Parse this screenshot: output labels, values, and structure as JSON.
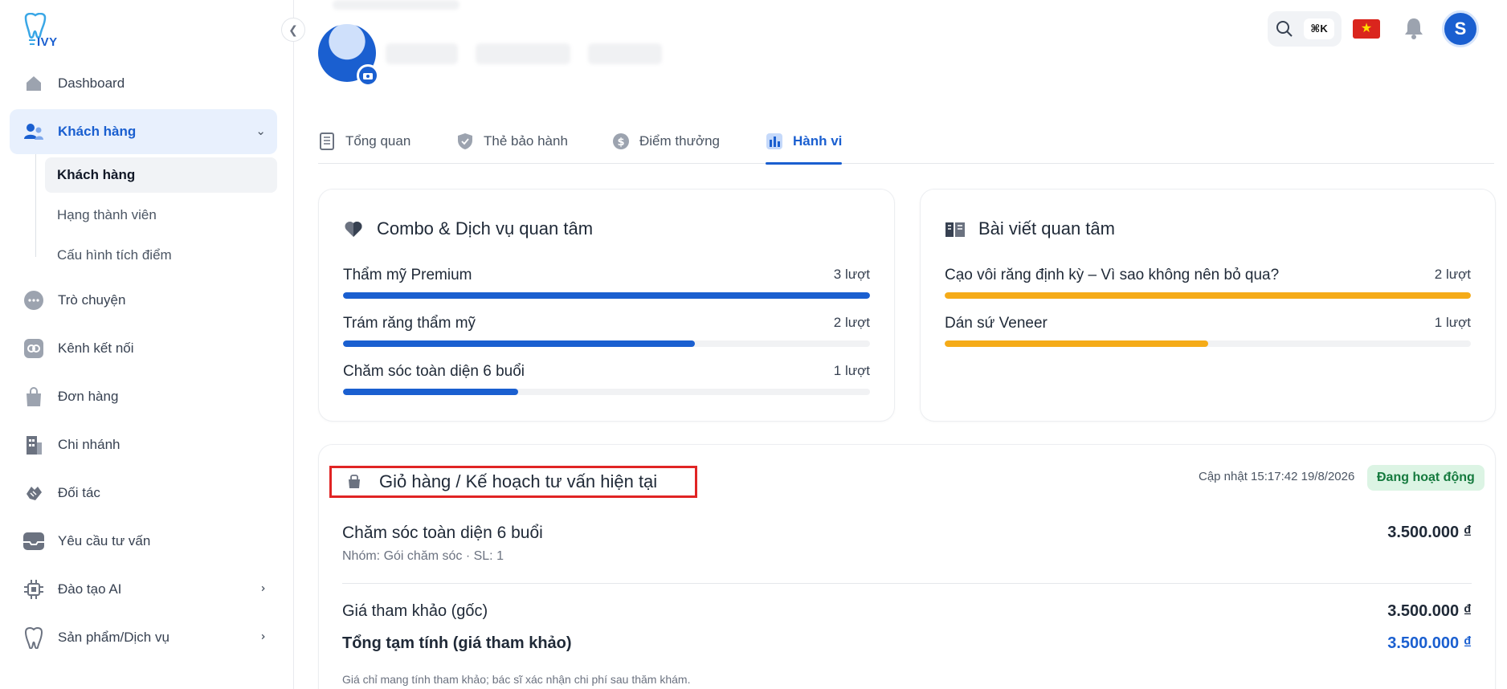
{
  "brand": {
    "logo_text": "IVY",
    "primary": "#1a5fd0"
  },
  "sidebar": {
    "items": [
      {
        "label": "Dashboard",
        "icon": "home-icon"
      },
      {
        "label": "Khách hàng",
        "icon": "users-icon",
        "active": true
      },
      {
        "label": "Trò chuyện",
        "icon": "chat-icon"
      },
      {
        "label": "Kênh kết nối",
        "icon": "link-icon"
      },
      {
        "label": "Đơn hàng",
        "icon": "bag-icon"
      },
      {
        "label": "Chi nhánh",
        "icon": "building-icon"
      },
      {
        "label": "Đối tác",
        "icon": "handshake-icon"
      },
      {
        "label": "Yêu cầu tư vấn",
        "icon": "inbox-icon"
      },
      {
        "label": "Đào tạo AI",
        "icon": "chip-icon"
      },
      {
        "label": "Sản phẩm/Dịch vụ",
        "icon": "tooth-icon"
      }
    ],
    "sub_items": [
      {
        "label": "Khách hàng",
        "active": true
      },
      {
        "label": "Hạng thành viên"
      },
      {
        "label": "Cấu hình tích điểm"
      }
    ]
  },
  "header": {
    "search_shortcut": "⌘K",
    "flag": "vn-flag-icon",
    "avatar_letter": "S"
  },
  "tabs": [
    {
      "label": "Tổng quan",
      "icon": "notebook-icon"
    },
    {
      "label": "Thẻ bảo hành",
      "icon": "shield-icon"
    },
    {
      "label": "Điểm thưởng",
      "icon": "dollar-icon"
    },
    {
      "label": "Hành vi",
      "icon": "chart-icon",
      "active": true
    }
  ],
  "combo_card": {
    "title": "Combo & Dịch vụ quan tâm",
    "rows": [
      {
        "name": "Thẩm mỹ Premium",
        "count": "3 lượt",
        "ratio": 1.0
      },
      {
        "name": "Trám răng thẩm mỹ",
        "count": "2 lượt",
        "ratio": 0.667
      },
      {
        "name": "Chăm sóc toàn diện 6 buổi",
        "count": "1 lượt",
        "ratio": 0.333
      }
    ],
    "bar_color": "#1a5fd0"
  },
  "articles_card": {
    "title": "Bài viết quan tâm",
    "rows": [
      {
        "name": "Cạo vôi răng định kỳ – Vì sao không nên bỏ qua?",
        "count": "2 lượt",
        "ratio": 1.0
      },
      {
        "name": "Dán sứ Veneer",
        "count": "1 lượt",
        "ratio": 0.5
      }
    ],
    "bar_color": "#f5ab18"
  },
  "cart_card": {
    "title": "Giỏ hàng / Kế hoạch tư vấn hiện tại",
    "updated": "Cập nhật 15:17:42 19/8/2026",
    "status": "Đang hoạt động",
    "item": {
      "name": "Chăm sóc toàn diện 6 buổi",
      "meta": "Nhóm: Gói chăm sóc · SL: 1",
      "price": "3.500.000 ₫"
    },
    "ref_label": "Giá tham khảo (gốc)",
    "ref_price": "3.500.000 ₫",
    "total_label": "Tổng tạm tính (giá tham khảo)",
    "total_price": "3.500.000 ₫",
    "note": "Giá chỉ mang tính tham khảo; bác sĩ xác nhận chi phí sau thăm khám."
  }
}
